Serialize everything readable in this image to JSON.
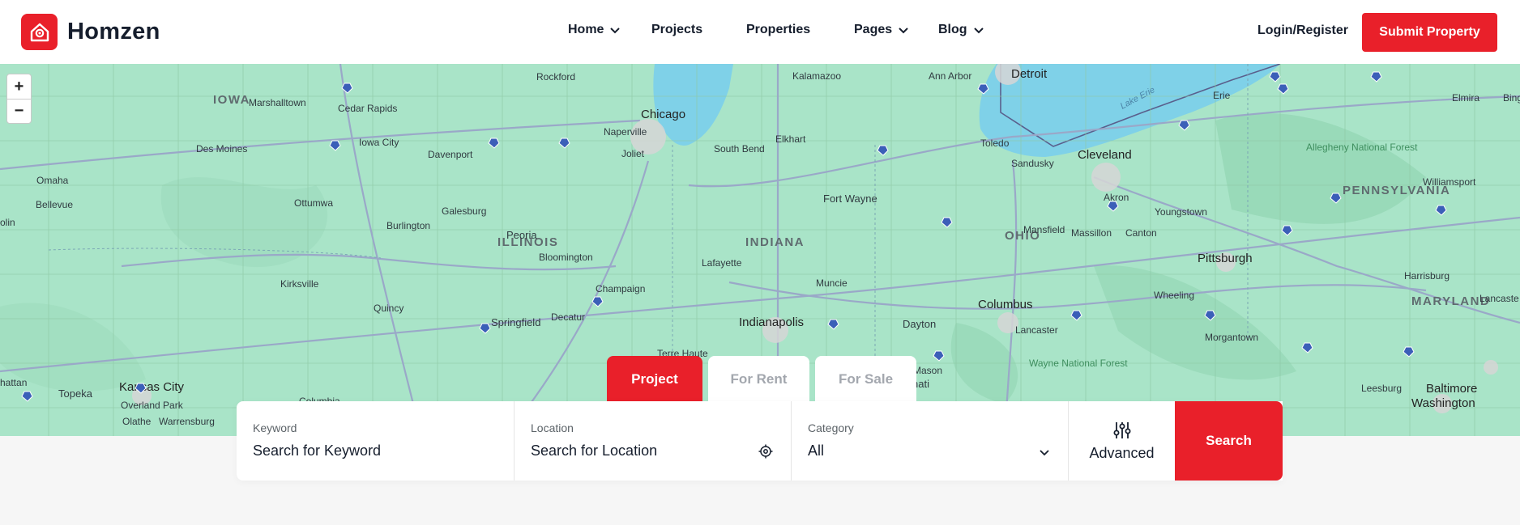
{
  "brand": {
    "name": "Homzen",
    "accent": "#e9202a"
  },
  "nav": {
    "items": [
      {
        "label": "Home",
        "has_dropdown": true
      },
      {
        "label": "Projects",
        "has_dropdown": false
      },
      {
        "label": "Properties",
        "has_dropdown": false
      },
      {
        "label": "Pages",
        "has_dropdown": true
      },
      {
        "label": "Blog",
        "has_dropdown": true
      }
    ],
    "login_label": "Login/Register",
    "submit_label": "Submit Property"
  },
  "map": {
    "zoom_in": "+",
    "zoom_out": "−",
    "states": [
      "IOWA",
      "ILLINOIS",
      "INDIANA",
      "OHIO",
      "PENNSYLVANIA",
      "MARYLAND"
    ],
    "cities": [
      "Rockford",
      "Kalamazoo",
      "Ann Arbor",
      "Detroit",
      "Erie",
      "Elmira",
      "Marshalltown",
      "Cedar Rapids",
      "Chicago",
      "Naperville",
      "Joliet",
      "South Bend",
      "Elkhart",
      "Toledo",
      "Sandusky",
      "Cleveland",
      "Des Moines",
      "Iowa City",
      "Davenport",
      "Omaha",
      "Bellevue",
      "Ottumwa",
      "Galesburg",
      "Burlington",
      "Peoria",
      "Fort Wayne",
      "Akron",
      "Youngstown",
      "Mansfield",
      "Massillon",
      "Canton",
      "Williamsport",
      "Bloomington",
      "Lafayette",
      "Pittsburgh",
      "Kirksville",
      "Champaign",
      "Muncie",
      "Wheeling",
      "Harrisburg",
      "Quincy",
      "Springfield",
      "Decatur",
      "Indianapolis",
      "Dayton",
      "Columbus",
      "Lancaster",
      "Morgantown",
      "Lancaste",
      "Terre Haute",
      "Mason",
      "Kansas City",
      "Topeka",
      "Overland Park",
      "Olathe",
      "Warrensburg",
      "Columbia",
      "Leesburg",
      "Baltimore",
      "Washington",
      "Allegheny National Forest",
      "Wayne National Forest",
      "Lake Erie",
      "olin",
      "hattan",
      "nati",
      "Bing"
    ]
  },
  "tabs": [
    {
      "label": "Project",
      "active": true
    },
    {
      "label": "For Rent",
      "active": false
    },
    {
      "label": "For Sale",
      "active": false
    }
  ],
  "search": {
    "keyword": {
      "label": "Keyword",
      "placeholder": "Search for Keyword"
    },
    "location": {
      "label": "Location",
      "placeholder": "Search for Location"
    },
    "category": {
      "label": "Category",
      "value": "All"
    },
    "advanced_label": "Advanced",
    "search_label": "Search"
  }
}
